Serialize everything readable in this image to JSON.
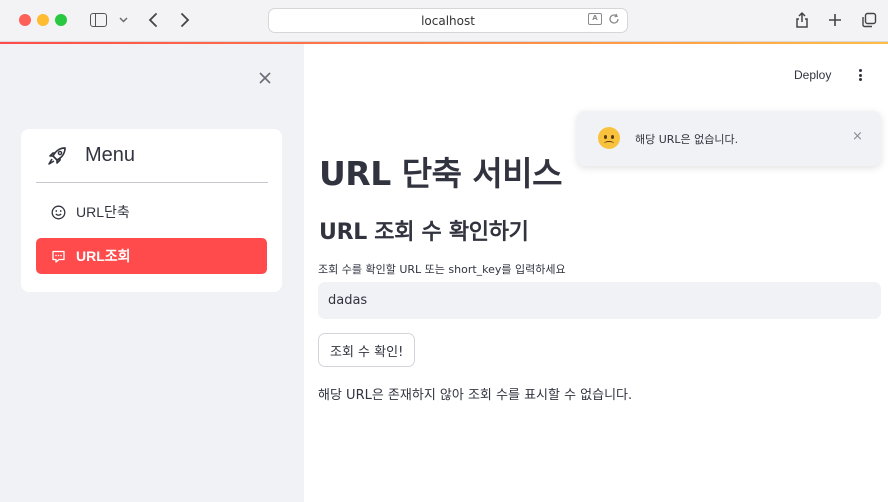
{
  "browser": {
    "address": "localhost"
  },
  "sidebar": {
    "menu_title": "Menu",
    "items": [
      {
        "label": "URL단축",
        "icon": "smiley-icon",
        "active": false
      },
      {
        "label": "URL조회",
        "icon": "chat-icon",
        "active": true
      }
    ]
  },
  "header": {
    "deploy_label": "Deploy"
  },
  "main": {
    "title": "URL 단축 서비스",
    "subtitle": "URL 조회 수 확인하기",
    "input_label": "조회 수를 확인할 URL 또는 short_key를 입력하세요",
    "input_value": "dadas",
    "button_label": "조회 수 확인!",
    "result_text": "해당 URL은 존재하지 않아 조회 수를 표시할 수 없습니다."
  },
  "toast": {
    "icon": "frowning-face-icon",
    "message": "해당 URL은 없습니다.",
    "close": "×"
  },
  "colors": {
    "accent": "#ff4b4b",
    "sidebar_bg": "#f0f2f6"
  }
}
